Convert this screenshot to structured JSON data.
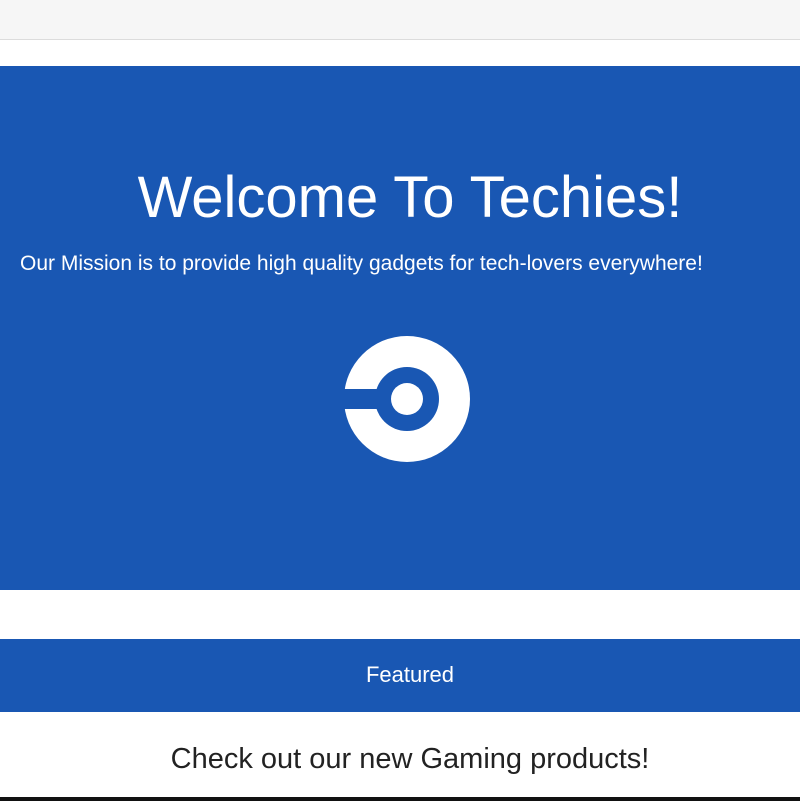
{
  "colors": {
    "brand_blue": "#1957b3",
    "topbar": "#f6f6f6",
    "text_on_blue": "#ffffff",
    "body_text": "#222222"
  },
  "hero": {
    "title": "Welcome To Techies!",
    "subtitle": "Our Mission is to provide high quality gadgets for tech-lovers everywhere!",
    "logo_icon": "circle-c-logo-icon"
  },
  "featured": {
    "label": "Featured"
  },
  "promo": {
    "text": "Check out our new Gaming products!"
  }
}
